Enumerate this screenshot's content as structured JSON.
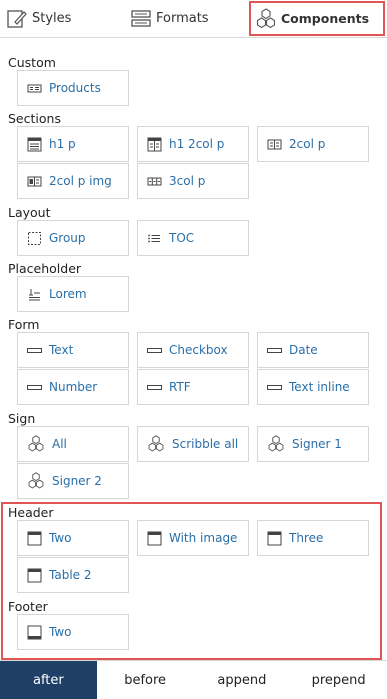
{
  "tabs": {
    "styles": {
      "label": "Styles",
      "icon": "pencil-icon"
    },
    "formats": {
      "label": "Formats",
      "icon": "formats-icon"
    },
    "components": {
      "label": "Components",
      "icon": "hexagons-icon"
    }
  },
  "sections": [
    {
      "label": "Custom",
      "buttons": [
        {
          "label": "Products",
          "icon": "products-icon"
        }
      ]
    },
    {
      "label": "Sections",
      "buttons": [
        {
          "label": "h1 p",
          "icon": "h1p-icon"
        },
        {
          "label": "h1 2col p",
          "icon": "h1-2col-icon"
        },
        {
          "label": "2col p",
          "icon": "2col-icon"
        },
        {
          "label": "2col p img",
          "icon": "2col-img-icon"
        },
        {
          "label": "3col p",
          "icon": "3col-icon"
        }
      ]
    },
    {
      "label": "Layout",
      "buttons": [
        {
          "label": "Group",
          "icon": "group-icon"
        },
        {
          "label": "TOC",
          "icon": "toc-icon"
        }
      ]
    },
    {
      "label": "Placeholder",
      "buttons": [
        {
          "label": "Lorem",
          "icon": "lorem-icon"
        }
      ]
    },
    {
      "label": "Form",
      "buttons": [
        {
          "label": "Text",
          "icon": "field-icon"
        },
        {
          "label": "Checkbox",
          "icon": "field-icon"
        },
        {
          "label": "Date",
          "icon": "field-icon"
        },
        {
          "label": "Number",
          "icon": "field-icon"
        },
        {
          "label": "RTF",
          "icon": "field-icon"
        },
        {
          "label": "Text inline",
          "icon": "field-icon"
        }
      ]
    },
    {
      "label": "Sign",
      "buttons": [
        {
          "label": "All",
          "icon": "hexagons-icon"
        },
        {
          "label": "Scribble all",
          "icon": "hexagons-icon"
        },
        {
          "label": "Signer 1",
          "icon": "hexagons-icon"
        },
        {
          "label": "Signer 2",
          "icon": "hexagons-icon"
        }
      ]
    },
    {
      "label": "Header",
      "buttons": [
        {
          "label": "Two",
          "icon": "header-icon"
        },
        {
          "label": "With image",
          "icon": "header-icon"
        },
        {
          "label": "Three",
          "icon": "header-icon"
        },
        {
          "label": "Table 2",
          "icon": "header-icon"
        }
      ]
    },
    {
      "label": "Footer",
      "buttons": [
        {
          "label": "Two",
          "icon": "footer-icon"
        }
      ]
    }
  ],
  "bottom": [
    "after",
    "before",
    "append",
    "prepend"
  ],
  "active_bottom": "after",
  "colors": {
    "accent": "#2a6fa8",
    "highlight": "#e05555",
    "active": "#1e3f66"
  }
}
